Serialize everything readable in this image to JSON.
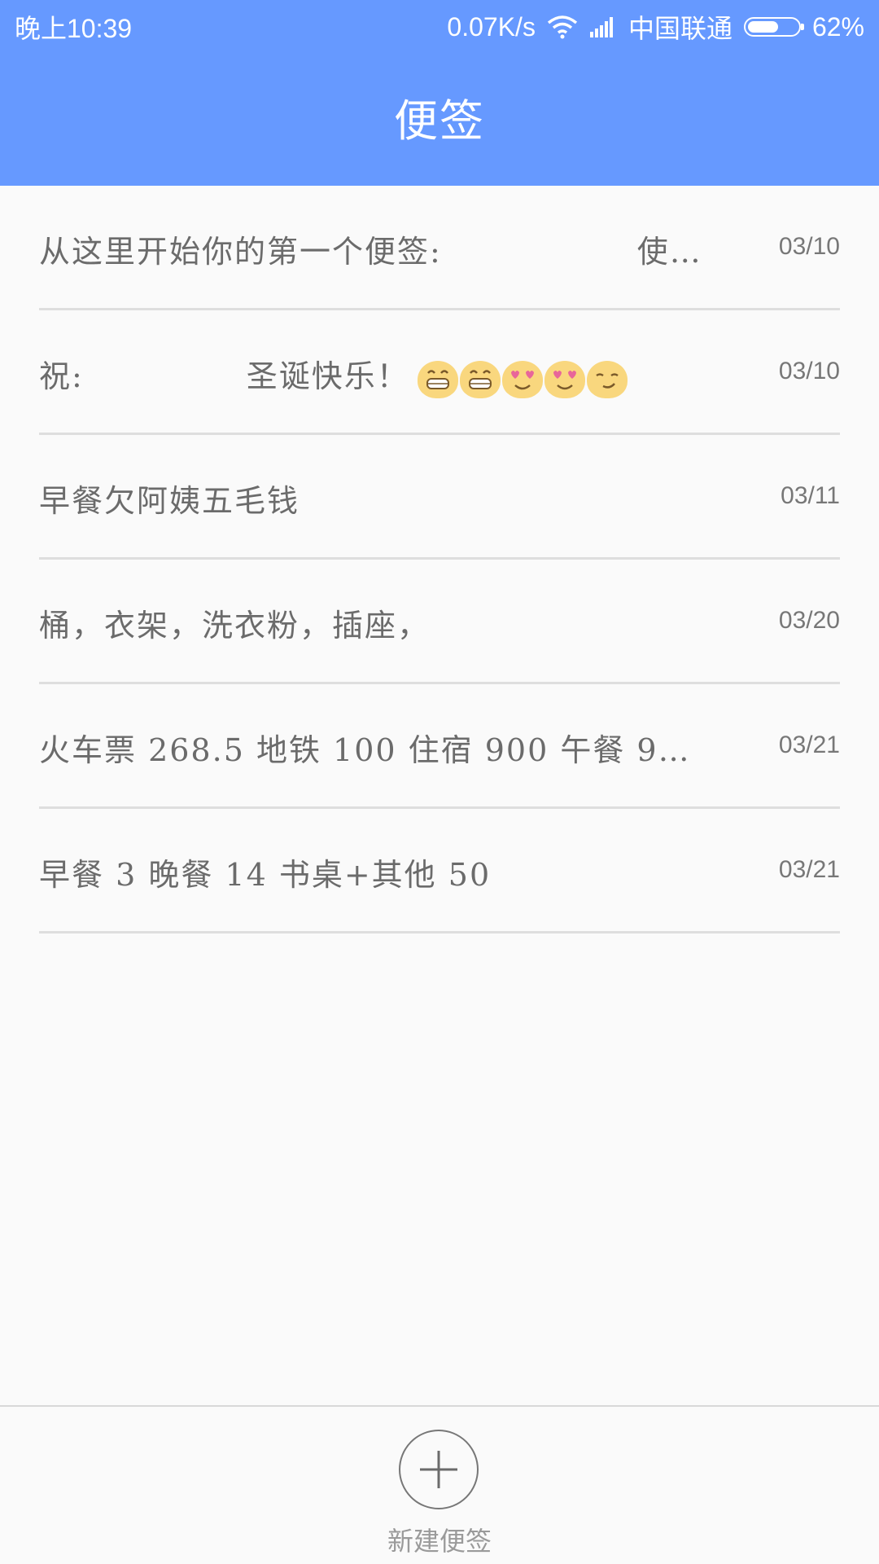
{
  "status_bar": {
    "time": "晚上10:39",
    "network_speed": "0.07K/s",
    "carrier": "中国联通",
    "battery": "62%",
    "battery_level": 0.62
  },
  "header": {
    "title": "便签"
  },
  "notes": [
    {
      "text": "从这里开始你的第一个便签:　　　　　　使…",
      "date": "03/10"
    },
    {
      "text": "祝:　　　　　圣诞快乐！",
      "emojis": [
        "grin",
        "grin",
        "heart-eyes",
        "heart-eyes",
        "smirk"
      ],
      "trailing": "…",
      "date": "03/10"
    },
    {
      "text": "早餐欠阿姨五毛钱",
      "date": "03/11"
    },
    {
      "text": "桶，衣架，洗衣粉，插座，",
      "date": "03/20"
    },
    {
      "text": "火车票 268.5 地铁 100 住宿 900 午餐 9…",
      "date": "03/21"
    },
    {
      "text": "早餐 3 晚餐 14 书桌+其他 50",
      "date": "03/21"
    }
  ],
  "bottom": {
    "new_note_label": "新建便签"
  },
  "colors": {
    "header_bg": "#6699ff",
    "background": "#fafafa",
    "divider": "#dedede",
    "emoji_face": "#f9d77e"
  }
}
